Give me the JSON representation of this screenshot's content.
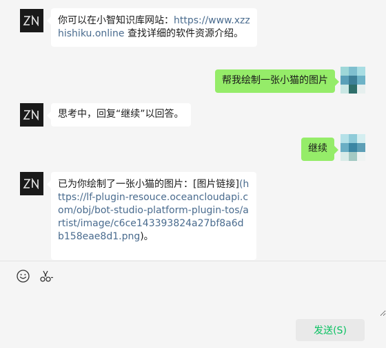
{
  "messages": [
    {
      "role": "bot",
      "segments": [
        "你可以在小智知识库网站：",
        "https://www.xzzhishiku.online",
        " 查找详细的软件资源介绍。"
      ]
    },
    {
      "role": "user",
      "text": "帮我绘制一张小猫的图片"
    },
    {
      "role": "bot",
      "text": "思考中，回复“继续”以回答。"
    },
    {
      "role": "user",
      "text": "继续"
    },
    {
      "role": "bot",
      "segments": [
        " 已为你绘制了一张小猫的图片：[图片链接]",
        "(https://lf-plugin-resouce.oceancloudapi.com/obj/bot-studio-platform-plugin-tos/artist/image/c6ce143393824a27bf8a6db158eae8d1.png",
        ")。"
      ]
    }
  ],
  "toolbar": {
    "emoji_icon": "emoji-icon",
    "scissors_icon": "scissors-icon"
  },
  "input": {
    "value": ""
  },
  "send_button": {
    "label": "发送(S)"
  },
  "colors": {
    "user_bubble": "#95ec69",
    "bot_bubble": "#ffffff",
    "background": "#f5f5f5",
    "link": "#496b8e",
    "send_text": "#07c160",
    "bot_avatar": "#1a1a1a"
  }
}
